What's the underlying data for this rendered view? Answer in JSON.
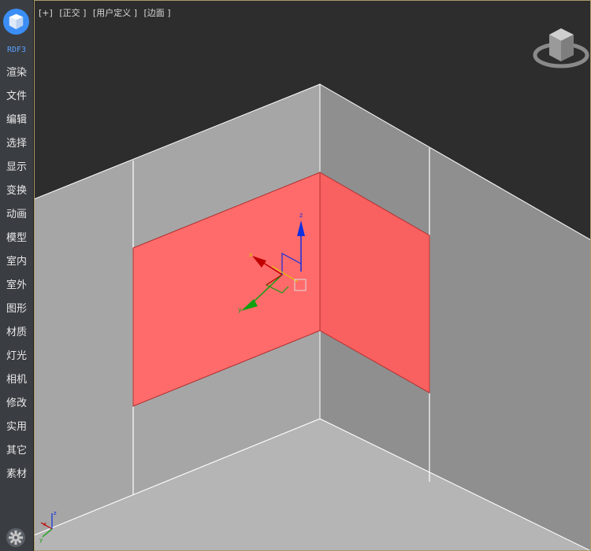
{
  "app": {
    "brand_label": "RDF3"
  },
  "sidebar": {
    "items": [
      {
        "label": "渲染"
      },
      {
        "label": "文件"
      },
      {
        "label": "编辑"
      },
      {
        "label": "选择"
      },
      {
        "label": "显示"
      },
      {
        "label": "变换"
      },
      {
        "label": "动画"
      },
      {
        "label": "模型"
      },
      {
        "label": "室内"
      },
      {
        "label": "室外"
      },
      {
        "label": "图形"
      },
      {
        "label": "材质"
      },
      {
        "label": "灯光"
      },
      {
        "label": "相机"
      },
      {
        "label": "修改"
      },
      {
        "label": "实用"
      },
      {
        "label": "其它"
      },
      {
        "label": "素材"
      }
    ]
  },
  "viewport": {
    "label_plus": "[+]",
    "label_view": "[正交 ]",
    "label_user": "[用户定义 ]",
    "label_shading": "[边面 ]"
  },
  "gizmo": {
    "axis_x": "x",
    "axis_y": "y",
    "axis_z": "z"
  },
  "mini_axes": {
    "axis_x": "x",
    "axis_y": "y",
    "axis_z": "z"
  },
  "colors": {
    "selected_face": "#ff6b6b",
    "axis_x": "#c00000",
    "axis_y": "#10a010",
    "axis_z": "#1030e0",
    "accent": "#3a8ef5"
  }
}
